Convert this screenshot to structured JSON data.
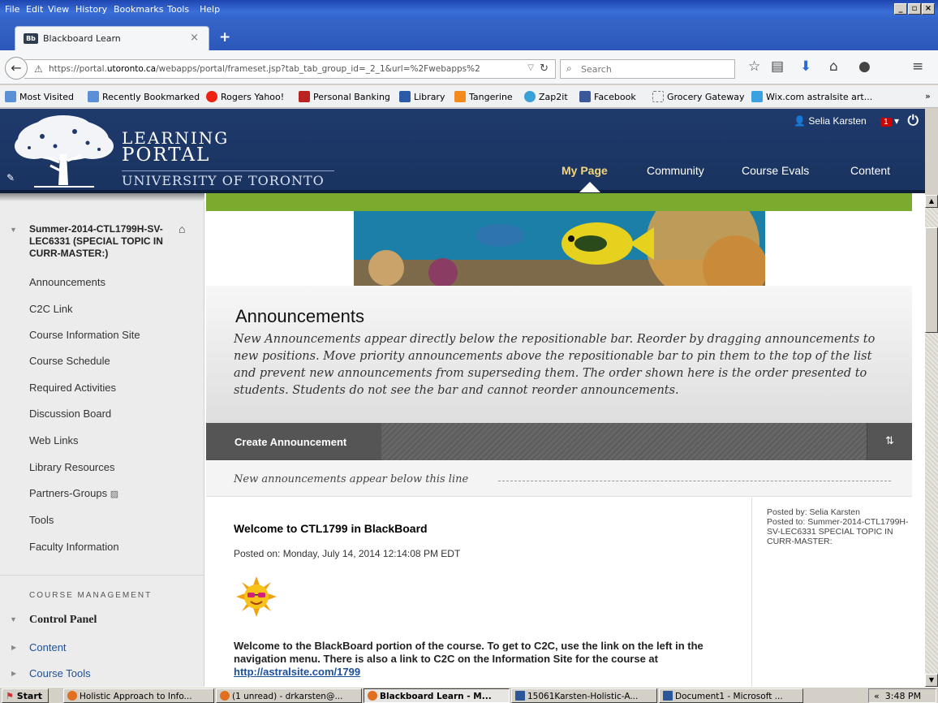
{
  "browser": {
    "menu": [
      "File",
      "Edit",
      "View",
      "History",
      "Bookmarks",
      "Tools",
      "Help"
    ],
    "tab_title": "Blackboard Learn",
    "tab_favicon": "Bb",
    "url_prefix": "https://portal.",
    "url_domain": "utoronto.ca",
    "url_rest": "/webapps/portal/frameset.jsp?tab_tab_group_id=_2_1&url=%2Fwebapps%2",
    "search_placeholder": "Search",
    "bookmarks": [
      "Most Visited",
      "Recently Bookmarked",
      "Rogers Yahoo!",
      "Personal Banking",
      "Library",
      "Tangerine",
      "Zap2it",
      "Facebook",
      "Grocery Gateway",
      "Wix.com astralsite art..."
    ],
    "bookmarks_overflow": "»"
  },
  "portal": {
    "logo_line1": "LEARNING",
    "logo_line2": "PORTAL",
    "logo_line3": "UNIVERSITY OF TORONTO",
    "user_name": "Selia Karsten",
    "notifications": "1",
    "tabs": [
      "My Page",
      "Community",
      "Course Evals",
      "Content"
    ]
  },
  "sidebar": {
    "course_title": "Summer-2014-CTL1799H-SV-LEC6331 (SPECIAL TOPIC IN CURR-MASTER:)",
    "items": [
      "Announcements",
      "C2C Link",
      "Course Information Site",
      "Course Schedule",
      "Required Activities",
      "Discussion Board",
      "Web Links",
      "Library Resources",
      "Partners-Groups",
      "Tools",
      "Faculty Information"
    ],
    "management_label": "COURSE MANAGEMENT",
    "control_panel": "Control Panel",
    "control_items": [
      "Content",
      "Course Tools"
    ]
  },
  "announcements": {
    "title": "Announcements",
    "description": "New Announcements appear directly below the repositionable bar. Reorder by dragging announcements to new positions. Move priority announcements above the repositionable bar to pin them to the top of the list and prevent new announcements from superseding them. The order shown here is the order presented to students. Students do not see the bar and cannot reorder announcements.",
    "create_button": "Create Announcement",
    "sort_icon": "⇅",
    "new_line_text": "New announcements appear below this line",
    "item": {
      "title": "Welcome to CTL1799 in BlackBoard",
      "posted_on": "Posted on: Monday, July 14, 2014 12:14:08 PM EDT",
      "body_part1": "Welcome to the BlackBoard portion of the course.  To get to C2C, use the link on the left in the navigation menu. There is also a link to C2C on the Information Site for the course at ",
      "body_link": "http://astralsite.com/1799",
      "posted_by": "Posted by: Selia Karsten",
      "posted_to": "Posted to: Summer-2014-CTL1799H-SV-LEC6331 SPECIAL TOPIC IN CURR-MASTER:"
    }
  },
  "taskbar": {
    "start": "Start",
    "tasks": [
      "Holistic Approach to Info...",
      "(1 unread) - drkarsten@...",
      "Blackboard Learn - M...",
      "15061Karsten-Holistic-A...",
      "Document1 - Microsoft ..."
    ],
    "clock": "3:48 PM",
    "tray_arrows": "«"
  }
}
